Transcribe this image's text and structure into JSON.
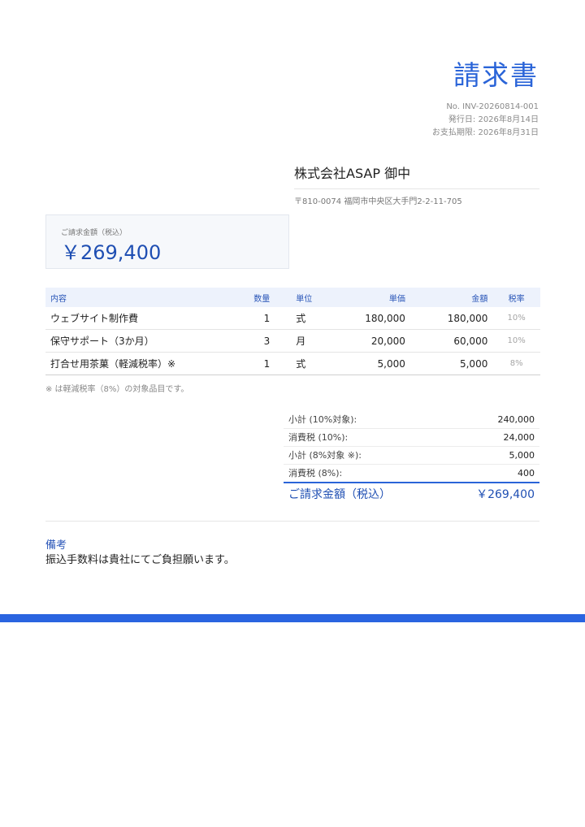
{
  "header": {
    "title": "請求書",
    "invoice_no": "No. INV-20260814-001",
    "issue_date": "発行日: 2026年8月14日",
    "due_date": "お支払期限: 2026年8月31日"
  },
  "client": {
    "name": "株式会社ASAP 御中",
    "address": "〒810-0074 福岡市中央区大手門2-2-11-705"
  },
  "total_box": {
    "label": "ご請求金額（税込）",
    "amount": "￥269,400"
  },
  "table": {
    "headers": {
      "name": "内容",
      "qty": "数量",
      "unit": "単位",
      "price": "単価",
      "amount": "金額",
      "rate": "税率"
    },
    "rows": [
      {
        "name": "ウェブサイト制作費",
        "qty": "1",
        "unit": "式",
        "price": "180,000",
        "amount": "180,000",
        "rate": "10%"
      },
      {
        "name": "保守サポート（3か月）",
        "qty": "3",
        "unit": "月",
        "price": "20,000",
        "amount": "60,000",
        "rate": "10%"
      },
      {
        "name": "打合せ用茶菓（軽減税率）※",
        "qty": "1",
        "unit": "式",
        "price": "5,000",
        "amount": "5,000",
        "rate": "8%"
      }
    ]
  },
  "note": "※ は軽減税率（8%）の対象品目です。",
  "summary": {
    "rows": [
      {
        "label": "小計 (10%対象):",
        "value": "240,000"
      },
      {
        "label": "消費税 (10%):",
        "value": "24,000"
      },
      {
        "label": "小計 (8%対象 ※):",
        "value": "5,000"
      },
      {
        "label": "消費税 (8%):",
        "value": "400"
      }
    ],
    "grand_label": "ご請求金額（税込）",
    "grand_value": "￥269,400"
  },
  "remarks": {
    "heading": "備考",
    "body": "振込手数料は貴社にてご負担願います。"
  },
  "colors": {
    "accent": "#2a64d8",
    "bar": "#2a64e0"
  }
}
